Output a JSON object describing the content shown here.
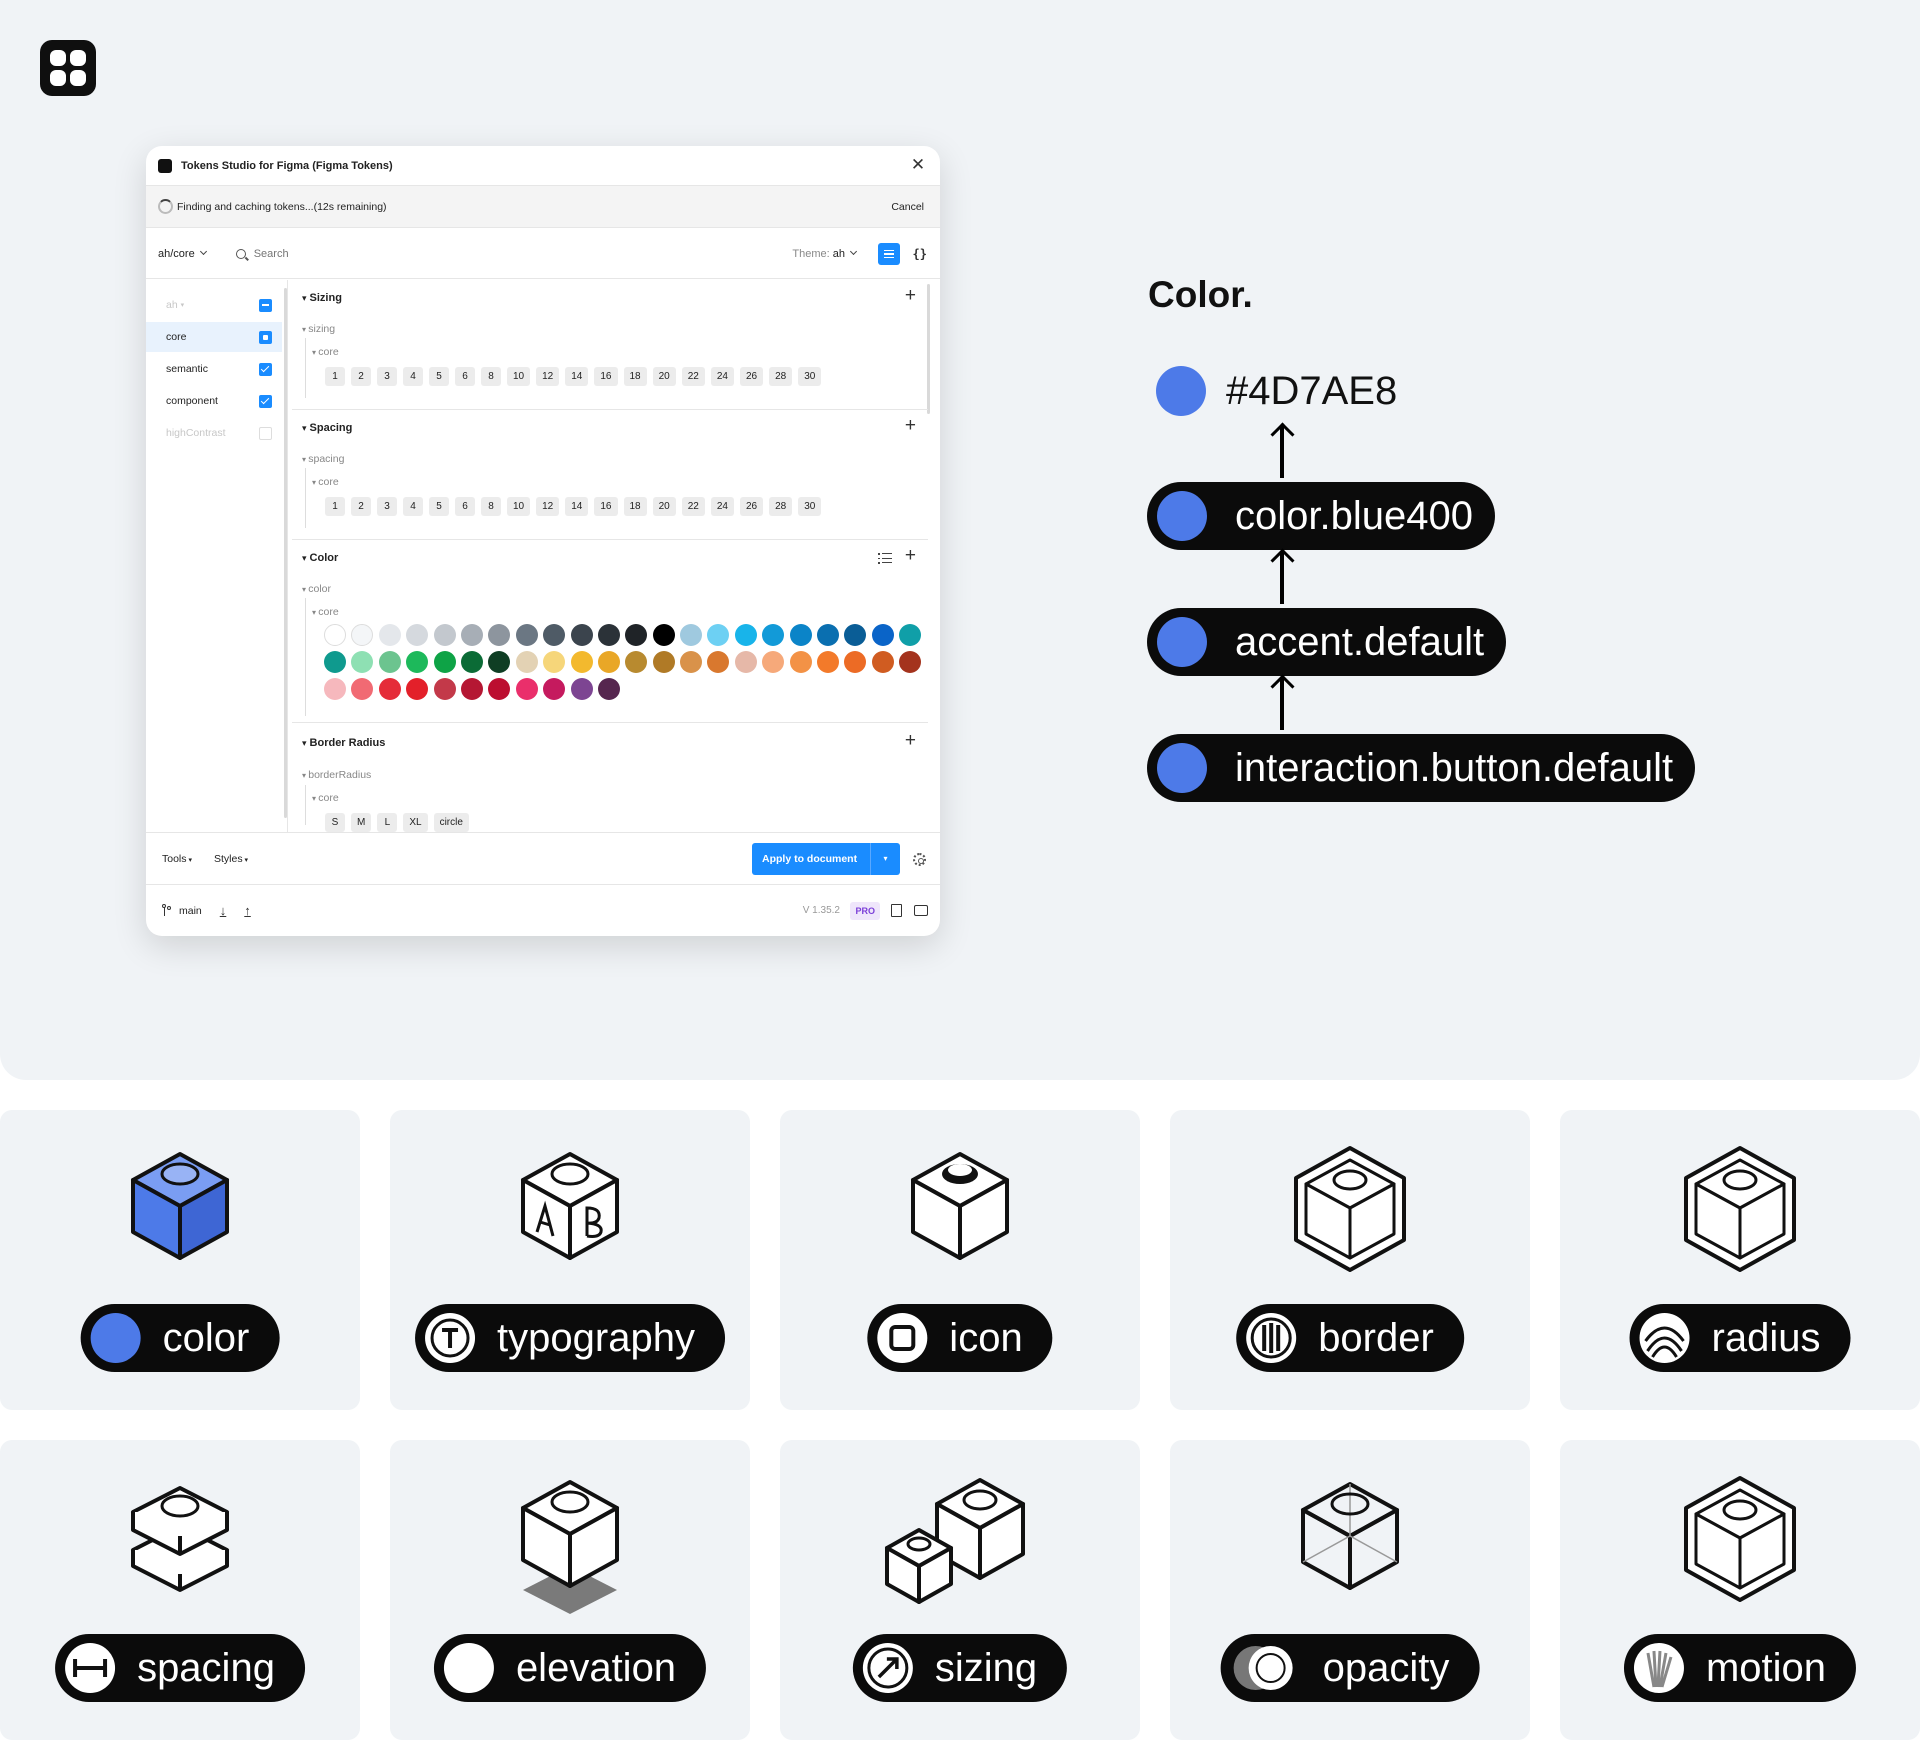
{
  "plugin": {
    "title": "Tokens Studio for Figma (Figma Tokens)",
    "progress_text": "Finding and caching tokens...(12s remaining)",
    "cancel_label": "Cancel",
    "token_set_path": "ah/core",
    "search_placeholder": "Search",
    "theme_label": "Theme:",
    "theme_value": "ah",
    "json_view_label": "{}",
    "sidebar": {
      "items": [
        {
          "label": "ah",
          "state": "partial",
          "muted": true
        },
        {
          "label": "core",
          "state": "active",
          "muted": false
        },
        {
          "label": "semantic",
          "state": "checked",
          "muted": false
        },
        {
          "label": "component",
          "state": "checked",
          "muted": false
        },
        {
          "label": "highContrast",
          "state": "unchecked",
          "muted": true
        }
      ]
    },
    "sections": {
      "sizing": {
        "title": "Sizing",
        "group": "sizing",
        "subgroup": "core",
        "values": [
          "1",
          "2",
          "3",
          "4",
          "5",
          "6",
          "8",
          "10",
          "12",
          "14",
          "16",
          "18",
          "20",
          "22",
          "24",
          "26",
          "28",
          "30"
        ]
      },
      "spacing": {
        "title": "Spacing",
        "group": "spacing",
        "subgroup": "core",
        "values": [
          "1",
          "2",
          "3",
          "4",
          "5",
          "6",
          "8",
          "10",
          "12",
          "14",
          "16",
          "18",
          "20",
          "22",
          "24",
          "26",
          "28",
          "30"
        ]
      },
      "color": {
        "title": "Color",
        "group": "color",
        "subgroup": "core",
        "swatches": [
          "#ffffff",
          "#f4f6f8",
          "#e4e7eb",
          "#d5d9de",
          "#c3c8ce",
          "#a7aeb6",
          "#8d959e",
          "#6b7783",
          "#4f5b66",
          "#3b444d",
          "#2b3238",
          "#1f2327",
          "#000000",
          "#9fc9df",
          "#6dd0f3",
          "#18b4ea",
          "#129ad8",
          "#0b84c8",
          "#0a6fb0",
          "#0a5d96",
          "#0a64c8",
          "#109fa8",
          "#0f9a8e",
          "#8ee0b3",
          "#6cc48f",
          "#1db95b",
          "#0ea346",
          "#0b6b36",
          "#0f3e24",
          "#e3d2b4",
          "#f6d67a",
          "#f3b92e",
          "#e9a727",
          "#b88a2f",
          "#b07a26",
          "#d9924a",
          "#d9782e",
          "#e6b8a8",
          "#f6a97a",
          "#f39246",
          "#f37a2a",
          "#ec6b25",
          "#d05c21",
          "#a4331d",
          "#f6b8bd",
          "#f16a73",
          "#e52c39",
          "#e3202a",
          "#c33949",
          "#b51733",
          "#bc0e30",
          "#ea2f6b",
          "#c51a5e",
          "#7d4592",
          "#56264f"
        ]
      },
      "border_radius": {
        "title": "Border Radius",
        "group": "borderRadius",
        "subgroup": "core",
        "values": [
          "S",
          "M",
          "L",
          "XL",
          "circle"
        ]
      }
    },
    "footer": {
      "tools_label": "Tools",
      "styles_label": "Styles",
      "apply_label": "Apply to document",
      "branch": "main",
      "version": "V 1.35.2",
      "pro_badge": "PRO"
    }
  },
  "color_chain": {
    "heading": "Color.",
    "hex": "#4D7AE8",
    "steps": [
      "color.blue400",
      "accent.default",
      "interaction.button.default"
    ],
    "accent_color": "#4D7AE8"
  },
  "token_types": [
    {
      "label": "color",
      "icon": "color-dot-icon"
    },
    {
      "label": "typography",
      "icon": "typography-t-icon"
    },
    {
      "label": "icon",
      "icon": "icon-square-icon"
    },
    {
      "label": "border",
      "icon": "border-lines-icon"
    },
    {
      "label": "radius",
      "icon": "radius-arcs-icon"
    },
    {
      "label": "spacing",
      "icon": "spacing-width-icon"
    },
    {
      "label": "elevation",
      "icon": "elevation-circle-icon"
    },
    {
      "label": "sizing",
      "icon": "sizing-arrow-icon"
    },
    {
      "label": "opacity",
      "icon": "opacity-circles-icon"
    },
    {
      "label": "motion",
      "icon": "motion-fan-icon"
    }
  ]
}
